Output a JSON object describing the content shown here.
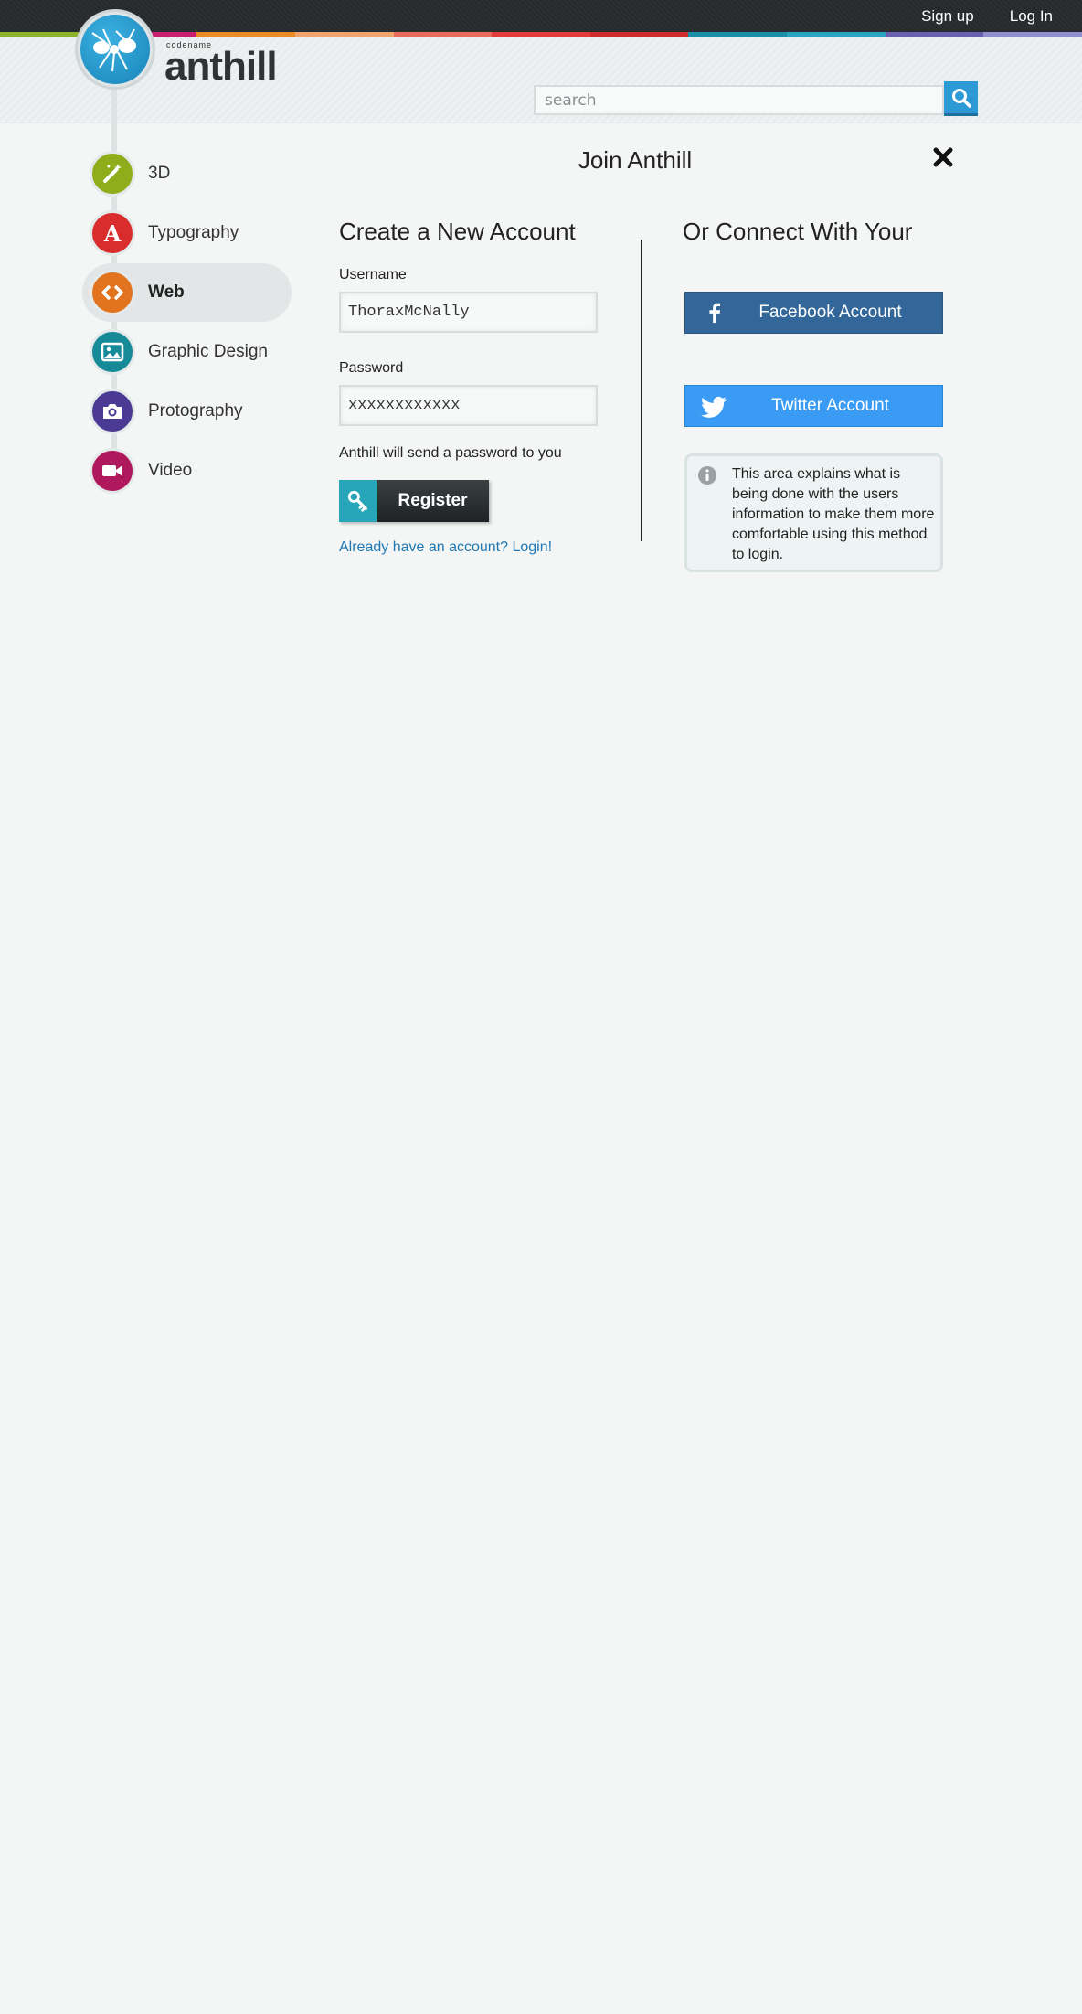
{
  "topnav": {
    "signup": "Sign up",
    "login": "Log In"
  },
  "brand": {
    "small": "codename",
    "name": "anthill"
  },
  "search": {
    "placeholder": "search"
  },
  "sidebar": {
    "items": [
      {
        "label": "3D",
        "icon": "wand-icon",
        "color": "#8fac1a"
      },
      {
        "label": "Typography",
        "icon": "letter-a-icon",
        "color": "#d92d2d"
      },
      {
        "label": "Web",
        "icon": "code-icon",
        "color": "#e27420",
        "active": true
      },
      {
        "label": "Graphic Design",
        "icon": "image-icon",
        "color": "#178a98"
      },
      {
        "label": "Protography",
        "icon": "camera-icon",
        "color": "#4a3a93"
      },
      {
        "label": "Video",
        "icon": "video-camera-icon",
        "color": "#b0185d"
      }
    ]
  },
  "modal": {
    "title": "Join Anthill",
    "create": {
      "heading": "Create a New Account",
      "username_label": "Username",
      "username_value": "ThoraxMcNally",
      "password_label": "Password",
      "password_value": "xxxxxxxxxxxx",
      "hint": "Anthill will send a password to you",
      "register_label": "Register",
      "login_link": "Already have an account? Login!"
    },
    "connect": {
      "heading": "Or Connect With Your",
      "facebook_label": "Facebook Account",
      "twitter_label": "Twitter Account",
      "info_text": "This area explains what is being done with the users information to make them more comfortable using this method to login."
    }
  },
  "colors": {
    "accent": "#2e9ad5",
    "facebook": "#336699",
    "twitter": "#3a9bf5",
    "link": "#1f77b4",
    "stripe": [
      "#8db22b",
      "#c91f6e",
      "#ec8a26",
      "#f0a36a",
      "#e86a5a",
      "#e33a3a",
      "#d12a2a",
      "#1c8fa8",
      "#28a6c0",
      "#6a60b0",
      "#8f8fd0"
    ]
  }
}
